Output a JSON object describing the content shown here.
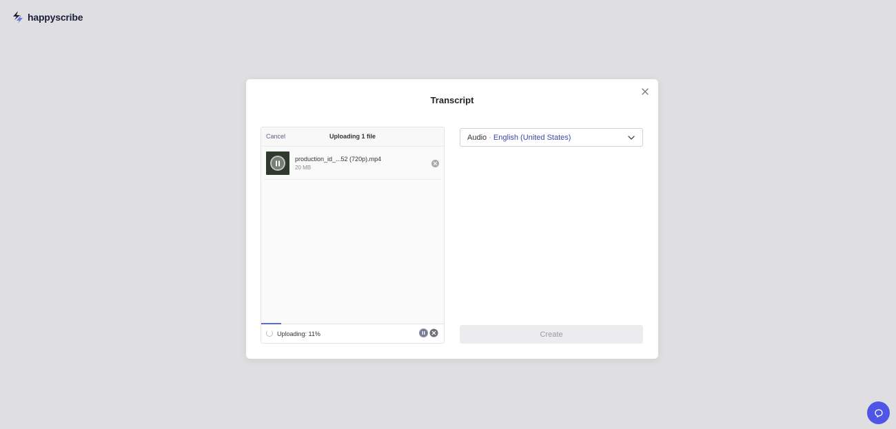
{
  "brand": {
    "name": "happyscribe",
    "logo_icon": "happyscribe-logo-icon"
  },
  "modal": {
    "title": "Transcript",
    "close_icon": "close-icon"
  },
  "upload": {
    "cancel_label": "Cancel",
    "header_title": "Uploading 1 file",
    "files": [
      {
        "name": "production_id_...52 (720p).mp4",
        "size": "20 MB",
        "thumb_icon": "pause-icon",
        "remove_icon": "remove-circle-icon"
      }
    ],
    "status_text": "Uploading: 11%",
    "progress_percent": 11,
    "pause_icon": "pause-circle-icon",
    "cancel_icon": "cancel-circle-icon"
  },
  "language_select": {
    "type": "Audio",
    "separator": " · ",
    "value": "English (United States)",
    "chevron_icon": "chevron-down-icon"
  },
  "create_button": {
    "label": "Create",
    "disabled": true
  },
  "help": {
    "icon": "chat-bubble-icon"
  },
  "colors": {
    "background": "#dfdfe1",
    "accent": "#4f56e6",
    "progress": "#5b6bd5",
    "language_value": "#3b46a8",
    "brand_text": "#1c1d3a"
  }
}
